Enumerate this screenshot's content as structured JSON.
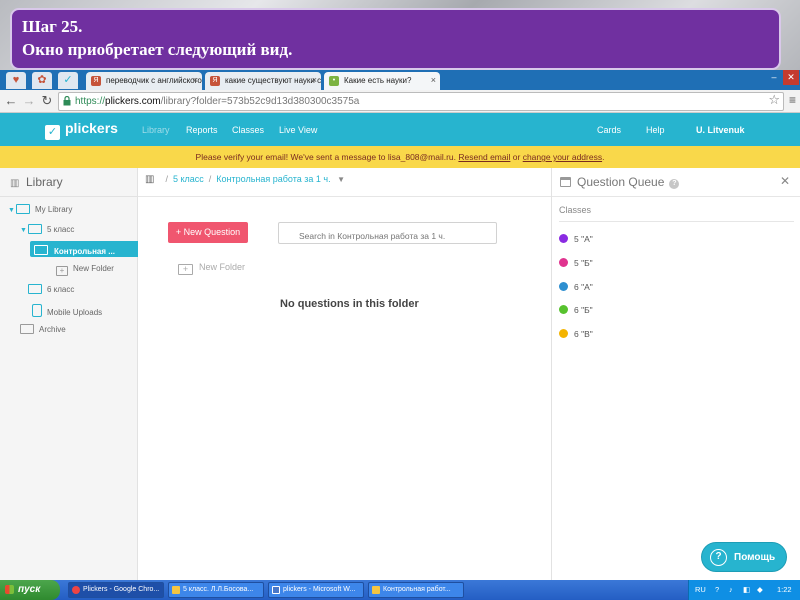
{
  "slide": {
    "step_title": "Шаг 25.",
    "step_text": "Окно приобретает следующий вид."
  },
  "browser": {
    "tabs": [
      {
        "label": "переводчик с английского",
        "favicon": "yandex-icon",
        "active": false
      },
      {
        "label": "какие существуют науки с",
        "favicon": "yandex-icon",
        "active": false
      },
      {
        "label": "Какие есть науки?",
        "favicon": "generic-page-icon",
        "active": true
      }
    ],
    "url": {
      "scheme": "https://",
      "host": "plickers.com",
      "path": "/library?folder=573b52c9d13d380300c3575a"
    }
  },
  "header": {
    "logo": "plickers",
    "nav": [
      "Library",
      "Reports",
      "Classes",
      "Live View"
    ],
    "right_nav": [
      "Cards",
      "Help",
      "U. Litvenuk"
    ],
    "brand_color": "#27b4cf"
  },
  "verify_banner": {
    "text": "Please verify your email! We've sent a message to lisa_808@mail.ru.",
    "resend": "Resend email",
    "or": "or",
    "change": "change your address",
    "end": "."
  },
  "sidebar": {
    "title": "Library",
    "tree": {
      "my_library": "My Library",
      "class5": "5 класс",
      "active_folder": "Контрольная ...",
      "new_folder": "New Folder",
      "class6": "6 класс",
      "mobile_uploads": "Mobile Uploads",
      "archive": "Archive"
    }
  },
  "main": {
    "breadcrumb": [
      "5 класс",
      "Контрольная работа за 1 ч."
    ],
    "new_question": "+ New Question",
    "search_placeholder": "Search in Контрольная работа за 1 ч.",
    "new_folder": "New Folder",
    "empty_message": "No questions in this folder"
  },
  "queue": {
    "title": "Question Queue",
    "classes_label": "Classes",
    "classes": [
      {
        "name": "5 \"А\"",
        "color": "#8a2be2"
      },
      {
        "name": "5 \"Б\"",
        "color": "#e0338f"
      },
      {
        "name": "6 \"А\"",
        "color": "#2e8fd0"
      },
      {
        "name": "6 \"Б\"",
        "color": "#57c22e"
      },
      {
        "name": "6 \"В\"",
        "color": "#f4b400"
      }
    ]
  },
  "help_button": "Помощь",
  "taskbar": {
    "start": "пуск",
    "tasks": [
      {
        "label": "Plickers - Google Chro...",
        "icon": "chrome-icon"
      },
      {
        "label": "5 класс. Л.Л.Босова...",
        "icon": "folder-icon"
      },
      {
        "label": "plickers - Microsoft W...",
        "icon": "word-icon"
      },
      {
        "label": "Контрольная работ...",
        "icon": "folder-icon"
      }
    ],
    "lang": "RU",
    "clock": "1:22"
  }
}
